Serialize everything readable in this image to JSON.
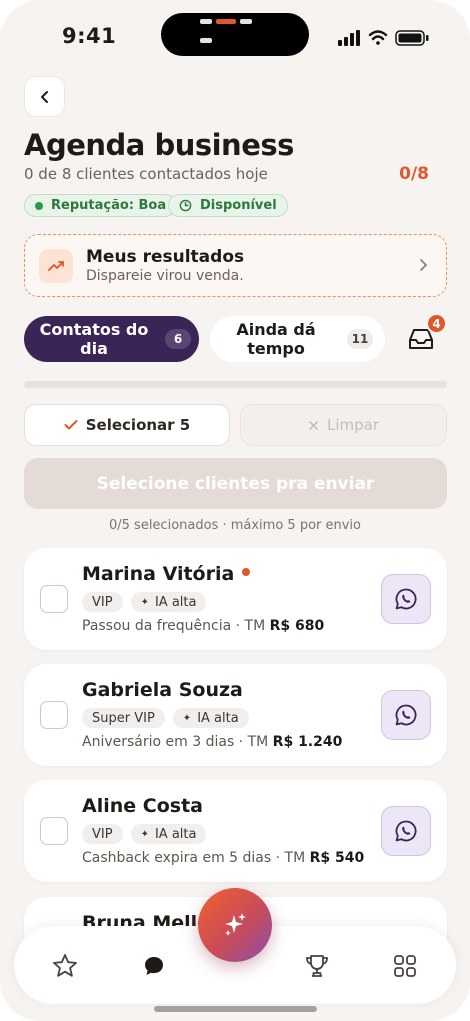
{
  "status_bar": {
    "time": "9:41"
  },
  "header": {
    "title": "Agenda business",
    "subtitle": "0 de 8 clientes contactados hoje",
    "counter": "0/8"
  },
  "pills": {
    "reputation": "Reputação: Boa",
    "availability": "Disponível"
  },
  "results_card": {
    "title": "Meus resultados",
    "subtitle": "Dispareie virou venda."
  },
  "tabs": [
    {
      "label": "Contatos do dia",
      "count": "6",
      "active": true
    },
    {
      "label": "Ainda dá tempo",
      "count": "11",
      "active": false
    }
  ],
  "inbox_badge": "4",
  "actions": {
    "select_label": "Selecionar 5",
    "clear_label": "Limpar",
    "send_label": "Selecione clientes pra enviar",
    "hint": "0/5 selecionados · máximo 5 por envio"
  },
  "clients": [
    {
      "name": "Marina Vitória",
      "unread": true,
      "tier": "VIP",
      "ai_tag": "IA alta",
      "info": "Passou da frequência · TM ",
      "amount": "R$ 680"
    },
    {
      "name": "Gabriela Souza",
      "unread": false,
      "tier": "Super VIP",
      "ai_tag": "IA alta",
      "info": "Aniversário em 3 dias · TM ",
      "amount": "R$ 1.240"
    },
    {
      "name": "Aline Costa",
      "unread": false,
      "tier": "VIP",
      "ai_tag": "IA alta",
      "info": "Cashback expira em 5 dias · TM ",
      "amount": "R$ 540"
    },
    {
      "name": "Bruna Mello"
    }
  ],
  "colors": {
    "accent": "#e0582a",
    "primary": "#3b2456",
    "background": "#f6f3f1",
    "success": "#2b7a3c"
  },
  "icons": {
    "back": "chevron-left-icon",
    "results": "trending-up-icon",
    "inbox": "inbox-icon",
    "whatsapp": "whatsapp-icon",
    "nav": [
      "star-icon",
      "chat-icon",
      "trophy-icon",
      "grid-icon"
    ],
    "fab": "sparkles-icon"
  }
}
